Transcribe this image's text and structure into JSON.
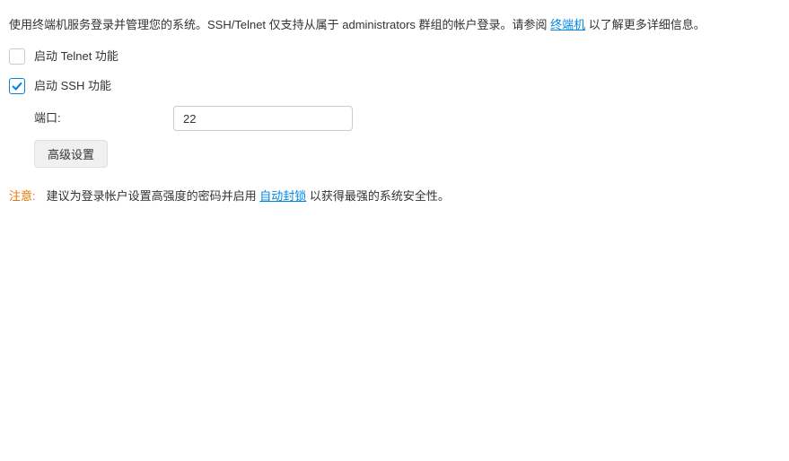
{
  "intro": {
    "before_link": "使用终端机服务登录并管理您的系统。SSH/Telnet 仅支持从属于 administrators 群组的帐户登录。请参阅 ",
    "link": "终端机",
    "after_link": " 以了解更多详细信息。"
  },
  "telnet": {
    "label": "启动 Telnet 功能",
    "checked": false
  },
  "ssh": {
    "label": "启动 SSH 功能",
    "checked": true,
    "port_label": "端口:",
    "port_value": "22",
    "advanced_button": "高级设置"
  },
  "note": {
    "label": "注意:",
    "before_link": "建议为登录帐户设置高强度的密码并启用 ",
    "link": "自动封锁",
    "after_link": " 以获得最强的系统安全性。"
  }
}
